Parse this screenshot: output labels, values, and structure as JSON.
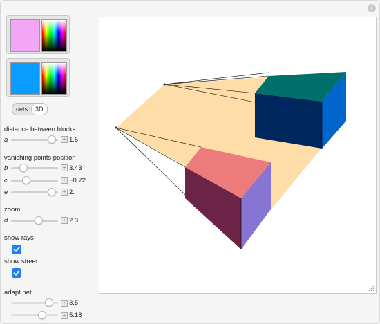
{
  "colors": {
    "swatch1": "#f2a6f5",
    "swatch2": "#0a9cff",
    "checkbox": "#1e7ef2"
  },
  "view_toggle": {
    "nets": "nets",
    "3d": "3D",
    "selected": "3D"
  },
  "labels": {
    "distance": "distance between blocks",
    "vanishing": "vanishing points position",
    "zoom": "zoom",
    "show_rays": "show rays",
    "show_street": "show street",
    "adapt_net": "adapt net"
  },
  "sliders": {
    "a": {
      "var": "a",
      "value": "1.5",
      "fraction": 0.92
    },
    "b": {
      "var": "b",
      "value": "3.43",
      "fraction": 0.2
    },
    "c": {
      "var": "c",
      "value": "−0.72",
      "fraction": 0.28
    },
    "e": {
      "var": "e",
      "value": "2.",
      "fraction": 0.92
    },
    "d": {
      "var": "d",
      "value": "2.3",
      "fraction": 0.58
    },
    "adapt1": {
      "value": "3.5",
      "fraction": 0.85
    },
    "adapt2": {
      "value": "5.18",
      "fraction": 0.67
    }
  },
  "checkboxes": {
    "show_rays": true,
    "show_street": true
  },
  "scene_colors": {
    "street": "#fedda9",
    "block1_top": "#00706c",
    "block1_front": "#00265e",
    "block1_side": "#0066cc",
    "block2_top": "#ee7b7b",
    "block2_front": "#6b2346",
    "block2_side": "#8675d3"
  }
}
